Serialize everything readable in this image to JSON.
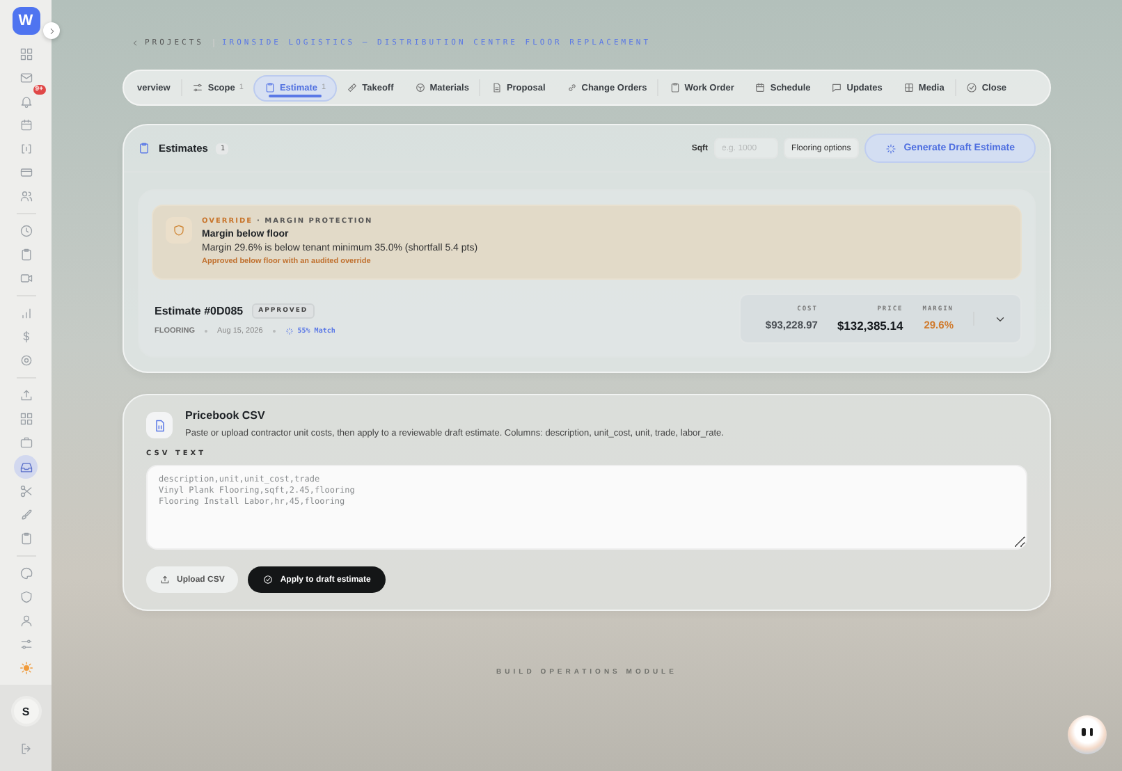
{
  "sidebar": {
    "logo": "W",
    "groups": [
      [
        {
          "selected": false
        },
        {
          "selected": false
        },
        {
          "selected": false,
          "badge": "9+"
        },
        {
          "selected": false
        },
        {
          "selected": false
        },
        {
          "selected": false
        },
        {
          "selected": false
        }
      ],
      [
        {
          "selected": false
        },
        {
          "selected": false
        },
        {
          "selected": false
        }
      ],
      [
        {
          "selected": false
        },
        {
          "selected": false
        },
        {
          "selected": false
        }
      ],
      [
        {
          "selected": false
        },
        {
          "selected": false
        },
        {
          "selected": false
        },
        {
          "selected": true
        },
        {
          "selected": false
        },
        {
          "selected": false
        },
        {
          "selected": false
        }
      ],
      [
        {
          "selected": false
        },
        {
          "selected": false
        },
        {
          "selected": false
        },
        {
          "selected": false
        },
        {
          "selected": false
        }
      ]
    ],
    "avatar": "S"
  },
  "breadcrumb": {
    "back": "PROJECTS",
    "current": "IRONSIDE LOGISTICS — DISTRIBUTION CENTRE FLOOR REPLACEMENT"
  },
  "tabs": [
    [
      {
        "label": "verview",
        "selected": false
      }
    ],
    [
      {
        "label": "Scope",
        "count": "1",
        "selected": false
      },
      {
        "label": "Estimate",
        "count": "1",
        "selected": true
      },
      {
        "label": "Takeoff",
        "selected": false
      },
      {
        "label": "Materials",
        "selected": false
      }
    ],
    [
      {
        "label": "Proposal",
        "selected": false
      },
      {
        "label": "Change Orders",
        "selected": false
      }
    ],
    [
      {
        "label": "Work Order",
        "selected": false
      },
      {
        "label": "Schedule",
        "selected": false
      },
      {
        "label": "Updates",
        "selected": false
      },
      {
        "label": "Media",
        "selected": false
      }
    ],
    [
      {
        "label": "Close",
        "selected": false
      }
    ]
  ],
  "estimates": {
    "title": "Estimates",
    "count": "1",
    "sqft_label": "Sqft",
    "sqft_placeholder": "e.g. 1000",
    "options_button": "Flooring options",
    "generate_button": "Generate Draft Estimate",
    "alert": {
      "tag": "OVERRIDE",
      "category": "· MARGIN PROTECTION",
      "title": "Margin below floor",
      "message": "Margin 29.6% is below tenant minimum 35.0% (shortfall 5.4 pts)",
      "note": "Approved below floor with an audited override"
    },
    "estimate": {
      "title": "Estimate #0D085",
      "status": "APPROVED",
      "trade": "FLOORING",
      "date": "Aug 15, 2026",
      "match": "55% Match",
      "expanded": false,
      "stats": [
        {
          "label": "COST",
          "value": "$93,228.97",
          "kind": "muted"
        },
        {
          "label": "PRICE",
          "value": "$132,385.14",
          "kind": "strong"
        },
        {
          "label": "MARGIN",
          "value": "29.6%",
          "kind": "warning"
        }
      ]
    }
  },
  "pricebook": {
    "title": "Pricebook CSV",
    "description": "Paste or upload contractor unit costs, then apply to a reviewable draft estimate. Columns: description, unit_cost, unit, trade, labor_rate.",
    "field_label": "CSV TEXT",
    "placeholder": "description,unit,unit_cost,trade\nVinyl Plank Flooring,sqft,2.45,flooring\nFlooring Install Labor,hr,45,flooring",
    "upload_button": "Upload CSV",
    "apply_button": "Apply to draft estimate"
  },
  "footer": "BUILD OPERATIONS MODULE"
}
